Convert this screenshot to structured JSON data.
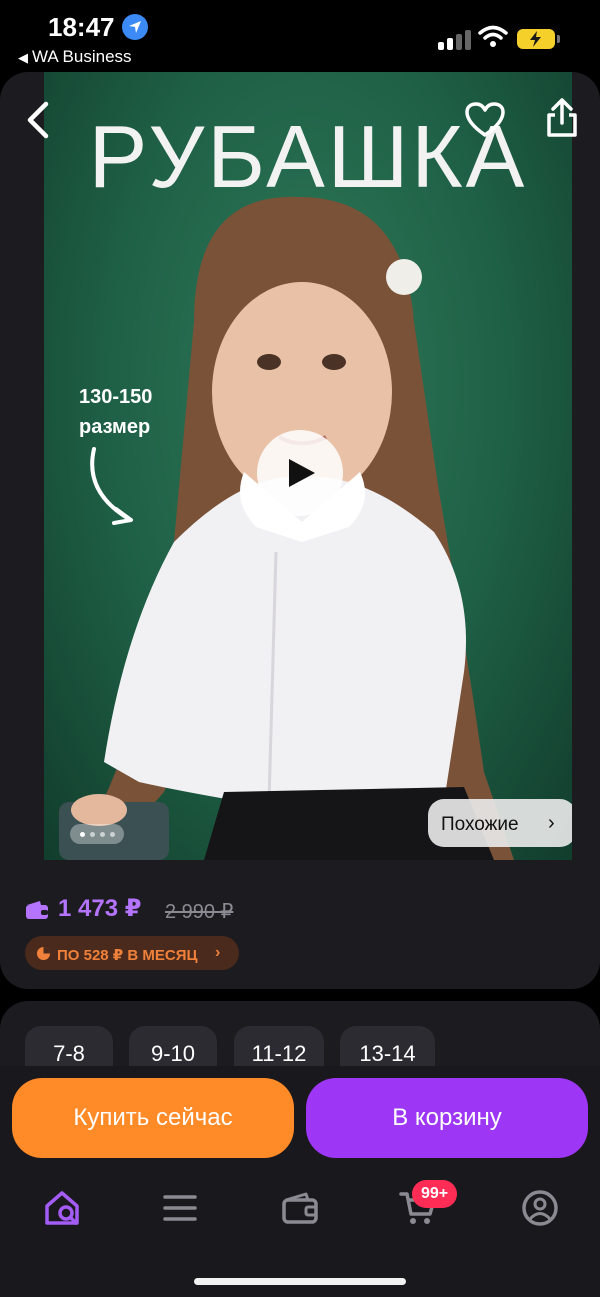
{
  "status_bar": {
    "time": "18:47",
    "back_app": "WA Business"
  },
  "product": {
    "photo_title": "РУБАШКА",
    "size_note_line1": "130-150",
    "size_note_line2": "размер",
    "photo_count": 4,
    "active_photo": 1,
    "similar_label": "Похожие",
    "price": "1 473 ₽",
    "old_price": "2 990 ₽",
    "installment": "ПО 528 ₽ В МЕСЯЦ"
  },
  "sizes": [
    "7-8",
    "9-10",
    "11-12",
    "13-14"
  ],
  "actions": {
    "buy_now": "Купить сейчас",
    "add_to_cart": "В корзину"
  },
  "tab_bar": {
    "items": [
      "home-search-icon",
      "catalog-icon",
      "wallet-icon",
      "cart-icon",
      "profile-icon"
    ],
    "cart_badge": "99+"
  },
  "colors": {
    "accent_purple": "#9d36f5",
    "price_purple": "#b574ff",
    "accent_orange": "#ff8a28",
    "badge_red": "#ff2d55"
  }
}
